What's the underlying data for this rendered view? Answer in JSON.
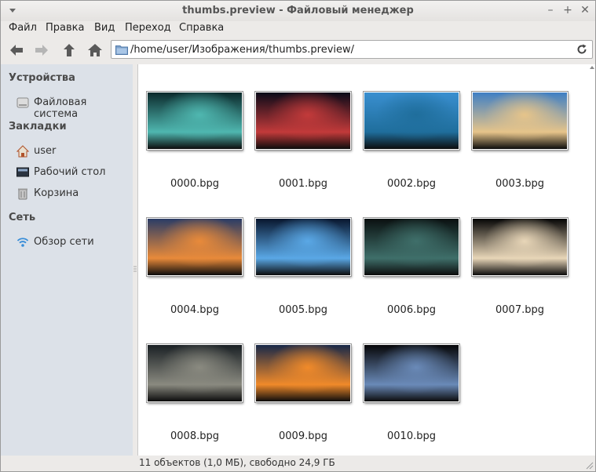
{
  "window": {
    "title": "thumbs.preview - Файловый менеджер"
  },
  "menu": {
    "file": "Файл",
    "edit": "Правка",
    "view": "Вид",
    "go": "Переход",
    "help": "Справка"
  },
  "address": {
    "path": "/home/user/Изображения/thumbs.preview/"
  },
  "sidebar": {
    "devices_header": "Устройства",
    "filesystem": "Файловая система",
    "bookmarks_header": "Закладки",
    "user": "user",
    "desktop": "Рабочий стол",
    "trash": "Корзина",
    "network_header": "Сеть",
    "browse_network": "Обзор сети"
  },
  "files": [
    {
      "name": "0000.bpg",
      "sky": "#0b2a2c",
      "glow": "#4fb7b0"
    },
    {
      "name": "0001.bpg",
      "sky": "#0a0a18",
      "glow": "#c23a3a"
    },
    {
      "name": "0002.bpg",
      "sky": "#3a8fd0",
      "glow": "#1f6e9c"
    },
    {
      "name": "0003.bpg",
      "sky": "#3f7fc4",
      "glow": "#e6c48a"
    },
    {
      "name": "0004.bpg",
      "sky": "#2a3c66",
      "glow": "#e88a3a"
    },
    {
      "name": "0005.bpg",
      "sky": "#08162e",
      "glow": "#5aa8e6"
    },
    {
      "name": "0006.bpg",
      "sky": "#0a1010",
      "glow": "#3f6f6a"
    },
    {
      "name": "0007.bpg",
      "sky": "#050505",
      "glow": "#e8d6b8"
    },
    {
      "name": "0008.bpg",
      "sky": "#1a2024",
      "glow": "#8a8a80"
    },
    {
      "name": "0009.bpg",
      "sky": "#182848",
      "glow": "#f08a2a"
    },
    {
      "name": "0010.bpg",
      "sky": "#060608",
      "glow": "#6a8ab8"
    }
  ],
  "status": {
    "text": "11 объектов (1,0 МБ), свободно 24,9 ГБ"
  }
}
